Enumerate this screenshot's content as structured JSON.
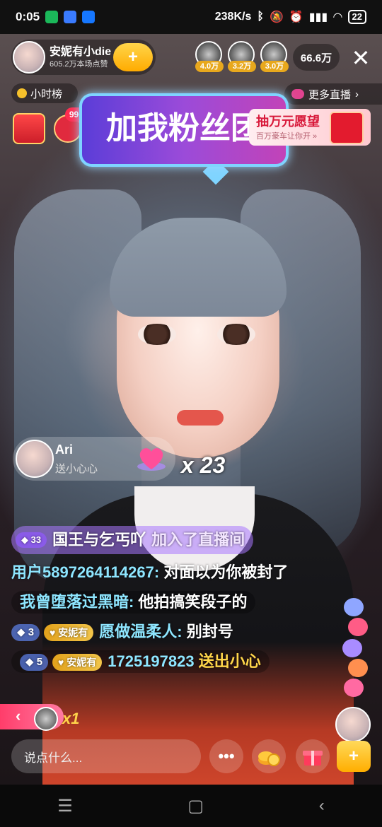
{
  "status_bar": {
    "time": "0:05",
    "network_speed": "238K/s",
    "battery": "22"
  },
  "host": {
    "name": "安妮有小die",
    "likes": "605.2万本场点赞",
    "follow_label": "+"
  },
  "viewers": [
    {
      "tag": "4.0万"
    },
    {
      "tag": "3.2万"
    },
    {
      "tag": "3.0万"
    }
  ],
  "viewer_count": "66.6万",
  "close_label": "✕",
  "hourly_rank_label": "小时榜",
  "more_live_label": "更多直播",
  "more_live_arrow": "›",
  "gift_badge": "99+",
  "fan_banner": "加我粉丝团",
  "wish_card": {
    "title": "抽万元愿望",
    "subtitle": "百万豪车让你开 »"
  },
  "gift_notice": {
    "user": "Ari",
    "action": "送小心心",
    "combo": "x 23"
  },
  "chat": [
    {
      "type": "join",
      "level": "33",
      "user": "国王与乞丐吖",
      "text": "加入了直播间"
    },
    {
      "type": "message",
      "user": "用户5897264114267:",
      "text": "对面以为你被封了"
    },
    {
      "type": "message",
      "user": "我曾堕落过黑暗:",
      "text": "他拍搞笑段子的"
    },
    {
      "type": "fan_message",
      "rank": "3",
      "fan_club": "安妮有",
      "user": "愿做温柔人:",
      "text": "别封号"
    },
    {
      "type": "fan_gift",
      "rank": "5",
      "fan_club": "安妮有",
      "user": "1725197823",
      "text": "送出小心"
    }
  ],
  "combo_strip": {
    "arrow": "‹",
    "count": "x1"
  },
  "input": {
    "placeholder": "说点什么..."
  },
  "more_button_label": "•••",
  "fan_button_label": "+",
  "nav": {
    "menu": "☰",
    "home": "▢",
    "back": "‹"
  },
  "colors": {
    "fan_gold": "#ffab00",
    "chat_user_cyan": "#8ee6ff",
    "gift_text_yellow": "#ffd64a",
    "join_purple": "#8a5be8"
  }
}
